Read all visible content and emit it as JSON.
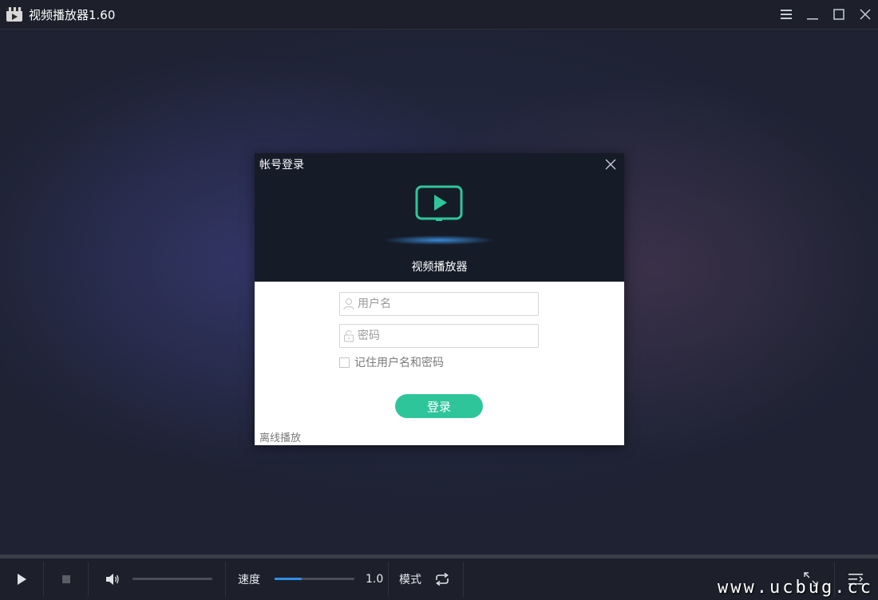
{
  "window": {
    "title": "视频播放器1.60"
  },
  "login_dialog": {
    "title": "帐号登录",
    "app_name": "视频播放器",
    "username_placeholder": "用户名",
    "password_placeholder": "密码",
    "remember_label": "记住用户名和密码",
    "remember_checked": false,
    "login_button": "登录",
    "offline_link": "离线播放",
    "accent_color": "#2fc59a"
  },
  "controls": {
    "volume_level": 0,
    "speed_label": "速度",
    "speed_fill_fraction": 0.34,
    "speed_value": "1.0",
    "mode_label": "模式",
    "slider_fill_color": "#2f8fe8"
  },
  "icons": {
    "titlebar": [
      "app-icon",
      "menu-icon",
      "minimize-icon",
      "maximize-icon",
      "close-icon"
    ],
    "controlbar": [
      "play-icon",
      "stop-icon",
      "volume-icon",
      "loop-icon",
      "fullscreen-icon",
      "playlist-icon"
    ]
  },
  "watermark": "www.ucbug.cc"
}
